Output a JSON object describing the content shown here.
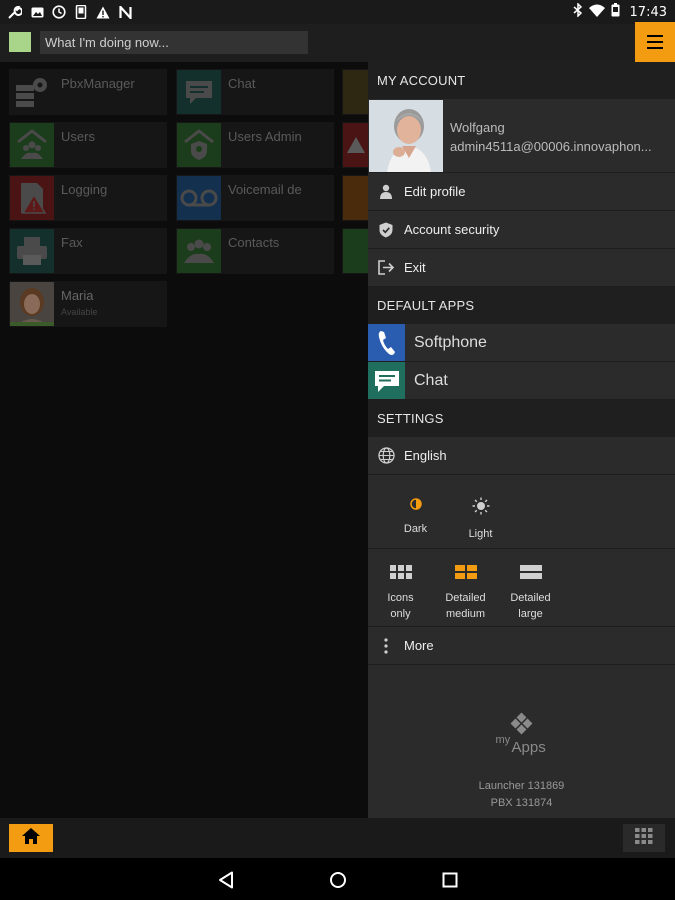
{
  "status_bar": {
    "left_icons": [
      "wrench-icon",
      "image-icon",
      "clock-icon",
      "phone-device-icon",
      "warning-icon",
      "n-icon"
    ],
    "right_icons": [
      "bluetooth-icon",
      "wifi-icon",
      "battery-icon"
    ],
    "time": "17:43"
  },
  "top_bar": {
    "status_placeholder": "What I'm doing now...",
    "presence_color": "#a8d58a"
  },
  "grid": {
    "tiles": [
      {
        "label": "PbxManager",
        "icon": "gear-icon",
        "color": "#2a2a2a"
      },
      {
        "label": "Chat",
        "icon": "chat-icon",
        "color": "#1f5a52"
      },
      {
        "label": "",
        "icon": "puzzle-icon",
        "color": "#4a3a10"
      },
      {
        "label": "Users",
        "icon": "users-icon",
        "color": "#2e6a2b"
      },
      {
        "label": "Users Admin",
        "icon": "users-admin-icon",
        "color": "#2e6a2b"
      },
      {
        "label": "",
        "icon": "warning-icon",
        "color": "#7a1c1c"
      },
      {
        "label": "Logging",
        "icon": "logging-icon",
        "color": "#7a1c1c"
      },
      {
        "label": "Voicemail de",
        "icon": "voicemail-icon",
        "color": "#1c4a7a"
      },
      {
        "label": "",
        "icon": "chart-icon",
        "color": "#7a4a14"
      },
      {
        "label": "Fax",
        "icon": "fax-icon",
        "color": "#1f5a52"
      },
      {
        "label": "Contacts",
        "icon": "contacts-icon",
        "color": "#2e6a2b"
      },
      {
        "label": "",
        "icon": "users-icon",
        "color": "#2e6a2b"
      },
      {
        "label": "Maria",
        "sub": "Available",
        "icon": "person-icon",
        "color": "#3a3a3a"
      }
    ]
  },
  "drawer": {
    "my_account": {
      "title": "MY ACCOUNT",
      "user_name": "Wolfgang",
      "user_email": "admin4511a@00006.innovaphon...",
      "items": [
        {
          "label": "Edit profile",
          "icon": "person-icon"
        },
        {
          "label": "Account security",
          "icon": "shield-icon"
        },
        {
          "label": "Exit",
          "icon": "exit-icon"
        }
      ]
    },
    "default_apps": {
      "title": "DEFAULT APPS",
      "items": [
        {
          "label": "Softphone",
          "icon": "phone-icon",
          "color": "#2a5db0"
        },
        {
          "label": "Chat",
          "icon": "chat-icon",
          "color": "#1f6e5e"
        }
      ]
    },
    "settings": {
      "title": "SETTINGS",
      "language": "English",
      "themes": [
        {
          "label": "Dark",
          "icon": "half-moon-icon",
          "selected": true
        },
        {
          "label": "Light",
          "icon": "sun-icon",
          "selected": false
        }
      ],
      "layouts": [
        {
          "label": "Icons only",
          "icon": "grid-small-icon",
          "selected": false
        },
        {
          "label": "Detailed medium",
          "icon": "grid-medium-icon",
          "selected": true
        },
        {
          "label": "Detailed large",
          "icon": "grid-large-icon",
          "selected": false
        }
      ],
      "more": "More"
    },
    "footer": {
      "logo_my": "my",
      "logo_apps": "Apps",
      "launcher": "Launcher 131869",
      "pbx": "PBX 131874"
    }
  },
  "accent_color": "#f39c12"
}
